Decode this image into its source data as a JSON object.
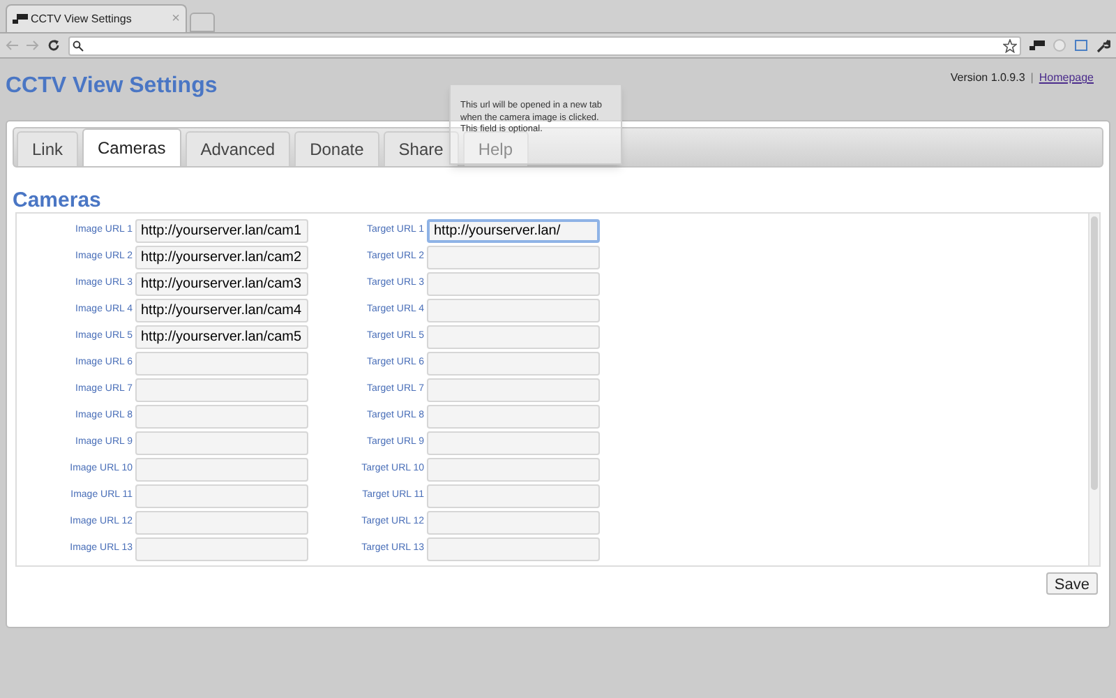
{
  "browser": {
    "tab_title": "CCTV View Settings",
    "tab_close": "×"
  },
  "page": {
    "title": "CCTV View Settings",
    "version": "Version 1.0.9.3",
    "separator": "|",
    "homepage_link": "Homepage"
  },
  "tabs": [
    {
      "label": "Link",
      "selected": false
    },
    {
      "label": "Cameras",
      "selected": true
    },
    {
      "label": "Advanced",
      "selected": false
    },
    {
      "label": "Donate",
      "selected": false
    },
    {
      "label": "Share",
      "selected": false
    },
    {
      "label": "Help",
      "selected": false
    }
  ],
  "tooltip": "This url will be opened in a new tab when the camera image is clicked. This field is optional.",
  "section_title": "Cameras",
  "rows": [
    {
      "image_label": "Image URL 1",
      "image_value": "http://yourserver.lan/cam1",
      "target_label": "Target URL 1",
      "target_value": "http://yourserver.lan/",
      "target_focused": true
    },
    {
      "image_label": "Image URL 2",
      "image_value": "http://yourserver.lan/cam2",
      "target_label": "Target URL 2",
      "target_focused": false
    },
    {
      "image_label": "Image URL 3",
      "image_value": "http://yourserver.lan/cam3",
      "target_label": "Target URL 3",
      "target_focused": false
    },
    {
      "image_label": "Image URL 4",
      "image_value": "http://yourserver.lan/cam4",
      "target_label": "Target URL 4",
      "target_focused": false
    },
    {
      "image_label": "Image URL 5",
      "image_value": "http://yourserver.lan/cam5",
      "target_label": "Target URL 5",
      "target_focused": false
    },
    {
      "image_label": "Image URL 6",
      "target_label": "Target URL 6",
      "target_focused": false
    },
    {
      "image_label": "Image URL 7",
      "target_label": "Target URL 7",
      "target_focused": false
    },
    {
      "image_label": "Image URL 8",
      "target_label": "Target URL 8",
      "target_focused": false
    },
    {
      "image_label": "Image URL 9",
      "target_label": "Target URL 9",
      "target_focused": false
    },
    {
      "image_label": "Image URL 10",
      "target_label": "Target URL 10",
      "target_focused": false
    },
    {
      "image_label": "Image URL 11",
      "target_label": "Target URL 11",
      "target_focused": false
    },
    {
      "image_label": "Image URL 12",
      "target_label": "Target URL 12",
      "target_focused": false
    },
    {
      "image_label": "Image URL 13",
      "target_label": "Target URL 13",
      "target_focused": false
    }
  ],
  "save_button": "Save"
}
